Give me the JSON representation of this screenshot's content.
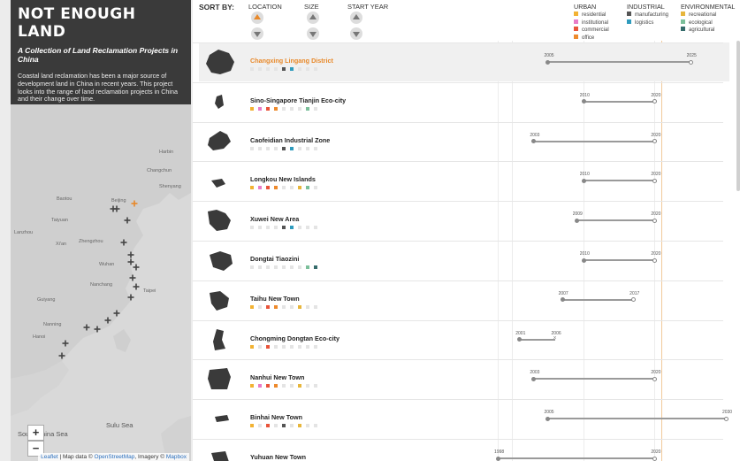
{
  "header": {
    "title": "NOT ENOUGH LAND",
    "subtitle": "A Collection of Land Reclamation Projects in China",
    "description": "Coastal land reclamation has been a major source of development land in China in recent years. This project looks into the range of land reclamation projects in China and their change over time."
  },
  "map": {
    "labels": [
      "Harbin",
      "Changchun",
      "Shenyang",
      "Beijing",
      "Baotou",
      "Taiyuan",
      "Lanzhou",
      "Xi'an",
      "Zhengzhou",
      "Wuhan",
      "Nanchang",
      "Guiyang",
      "Nanning",
      "Hanoi",
      "South China Sea",
      "Sulu Sea",
      "Taipei"
    ],
    "zoom_in": "+",
    "zoom_out": "−",
    "attribution": {
      "leaflet": "Leaflet",
      "mid": " | Map data © ",
      "osm": "OpenStreetMap",
      "img": ", Imagery © ",
      "mapbox": "Mapbox"
    }
  },
  "sort": {
    "label": "SORT BY:",
    "columns": [
      "LOCATION",
      "SIZE",
      "START YEAR"
    ],
    "active": "LOCATION"
  },
  "legend": {
    "groups": [
      {
        "title": "URBAN",
        "items": [
          {
            "label": "residential",
            "color": "#f2b233"
          },
          {
            "label": "institutional",
            "color": "#e97cc8"
          },
          {
            "label": "commercial",
            "color": "#e8543a"
          },
          {
            "label": "office",
            "color": "#ee8a2c"
          }
        ]
      },
      {
        "title": "INDUSTRIAL",
        "items": [
          {
            "label": "manufacturing",
            "color": "#555555"
          },
          {
            "label": "logistics",
            "color": "#2f9bbd"
          }
        ]
      },
      {
        "title": "ENVIRONMENTAL",
        "items": [
          {
            "label": "recreational",
            "color": "#e7b63c"
          },
          {
            "label": "ecological",
            "color": "#7bbf9a"
          },
          {
            "label": "agricultural",
            "color": "#356b6b"
          }
        ]
      }
    ]
  },
  "timeline": {
    "current_year": 2021
  },
  "projects": [
    {
      "name": "Changxing Lingang District",
      "start": 2005,
      "end": 2025,
      "end_icon": "circle",
      "dots": [
        "",
        "",
        "",
        "",
        "#555555",
        "#2f9bbd",
        "",
        "",
        ""
      ]
    },
    {
      "name": "Sino-Singapore Tianjin Eco-city",
      "start": 2010,
      "end": 2020,
      "end_icon": "circle",
      "dots": [
        "#f2b233",
        "#e97cc8",
        "#e8543a",
        "#ee8a2c",
        "",
        "",
        "",
        "#7bbf9a",
        ""
      ]
    },
    {
      "name": "Caofeidian Industrial Zone",
      "start": 2003,
      "end": 2020,
      "end_icon": "circle",
      "dots": [
        "",
        "",
        "",
        "",
        "#555555",
        "#2f9bbd",
        "",
        "",
        ""
      ]
    },
    {
      "name": "Longkou New Islands",
      "start": 2010,
      "end": 2020,
      "end_icon": "circle",
      "dots": [
        "#f2b233",
        "#e97cc8",
        "#e8543a",
        "#ee8a2c",
        "",
        "",
        "#e7b63c",
        "#7bbf9a",
        ""
      ]
    },
    {
      "name": "Xuwei New Area",
      "start": 2009,
      "end": 2020,
      "end_icon": "circle",
      "dots": [
        "",
        "",
        "",
        "",
        "#555555",
        "#2f9bbd",
        "",
        "",
        ""
      ]
    },
    {
      "name": "Dongtai Tiaozini",
      "start": 2010,
      "end": 2020,
      "end_icon": "circle",
      "dots": [
        "",
        "",
        "",
        "",
        "",
        "",
        "",
        "#7bbf9a",
        "#356b6b"
      ]
    },
    {
      "name": "Taihu New Town",
      "start": 2007,
      "end": 2017,
      "end_icon": "circle",
      "dots": [
        "#f2b233",
        "",
        "#e8543a",
        "#ee8a2c",
        "",
        "",
        "#e7b63c",
        "",
        ""
      ]
    },
    {
      "name": "Chongming Dongtan Eco-city",
      "start": 2001,
      "end": 2006,
      "end_icon": "cross",
      "dots": [
        "#f2b233",
        "",
        "#e8543a",
        "",
        "",
        "",
        "",
        "",
        ""
      ]
    },
    {
      "name": "Nanhui New Town",
      "start": 2003,
      "end": 2020,
      "end_icon": "circle",
      "dots": [
        "#f2b233",
        "#e97cc8",
        "#e8543a",
        "#ee8a2c",
        "",
        "",
        "#e7b63c",
        "",
        ""
      ]
    },
    {
      "name": "Binhai New Town",
      "start": 2005,
      "end": 2030,
      "end_icon": "circle",
      "dots": [
        "#f2b233",
        "",
        "#e8543a",
        "",
        "#555555",
        "",
        "#e7b63c",
        "",
        ""
      ]
    },
    {
      "name": "Yuhuan New Town",
      "start": 1998,
      "end": 2020,
      "end_icon": "circle",
      "dots": []
    }
  ]
}
